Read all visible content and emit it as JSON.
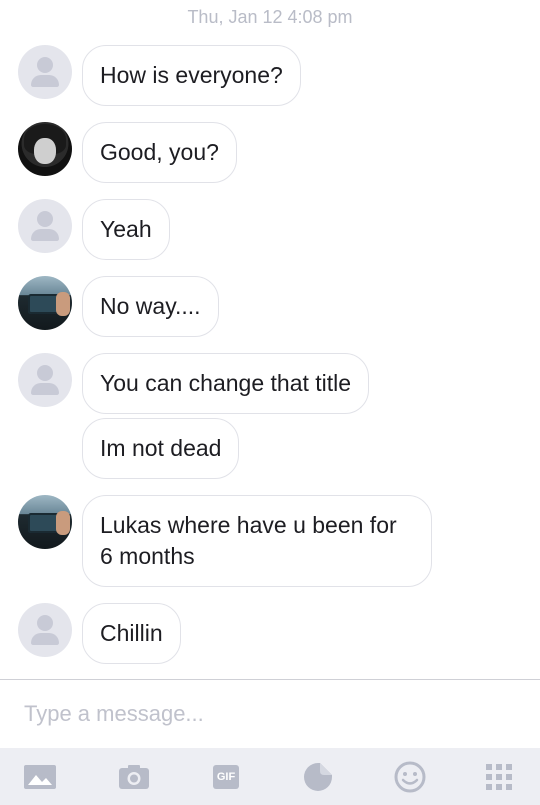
{
  "conversation": {
    "timestamp": "Thu, Jan 12 4:08 pm",
    "messages": [
      {
        "text": "How is everyone?",
        "avatar": "default-avatar"
      },
      {
        "text": "Good, you?",
        "avatar": "dark-photo-avatar"
      },
      {
        "text": "Yeah",
        "avatar": "default-avatar"
      },
      {
        "text": "No way....",
        "avatar": "photo-avatar"
      },
      {
        "text": "You can change that title",
        "avatar": "default-avatar"
      },
      {
        "text": "Im not dead",
        "avatar": "default-avatar"
      },
      {
        "text": "Lukas where have u been for\n6 months",
        "avatar": "photo-avatar"
      },
      {
        "text": "Chillin",
        "avatar": "default-avatar"
      }
    ]
  },
  "composer": {
    "placeholder": "Type a message..."
  },
  "toolbar": {
    "items": [
      {
        "icon": "image-icon"
      },
      {
        "icon": "camera-icon"
      },
      {
        "icon": "gif-icon",
        "label": "GIF"
      },
      {
        "icon": "sticker-icon"
      },
      {
        "icon": "emoji-icon"
      },
      {
        "icon": "more-grid-icon"
      }
    ]
  },
  "colors": {
    "icon_gray": "#b7bbc8",
    "bubble_border": "#e1e2e8",
    "timestamp_text": "#b9bcc7",
    "toolbar_bg": "#edeef3"
  }
}
